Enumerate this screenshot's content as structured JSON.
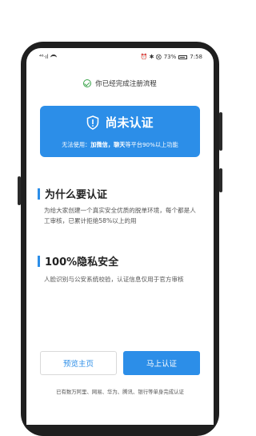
{
  "statusbar": {
    "left": "⁴⁶ᐧıl",
    "right_icons": "⏰ ✱ ⨂",
    "battery": "73%",
    "time": "7:58"
  },
  "registration": {
    "text": "你已经完成注册流程"
  },
  "banner": {
    "title": "尚未认证",
    "desc_prefix": "无法使用：",
    "desc_highlight": "加微信，聊天",
    "desc_suffix": "等平台90%以上功能"
  },
  "section1": {
    "title": "为什么要认证",
    "body": "为给大家创建一个真实安全优质的脱单环境，每个都是人工审核，已累计拒绝58%以上的用"
  },
  "section2": {
    "title": "100%隐私安全",
    "body": "人脸识别与公安系统校验，认证信息仅用于官方审核"
  },
  "buttons": {
    "preview": "预览主页",
    "verify": "马上认证"
  },
  "footer": {
    "text": "已有数万阿里、网易、华为、腾讯、银行等单身完成认证"
  },
  "colors": {
    "accent": "#2c8ee8",
    "success": "#3aa44a"
  }
}
